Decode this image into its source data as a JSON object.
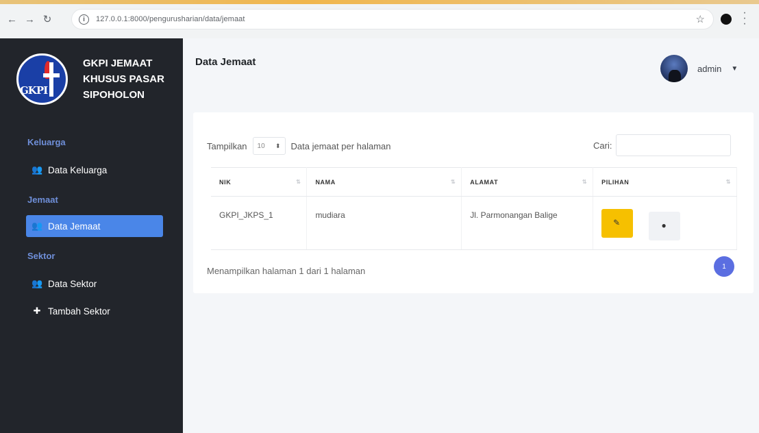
{
  "browser": {
    "url": "127.0.0.1:8000/pengurusharian/data/jemaat"
  },
  "sidebar": {
    "brand": {
      "line1": "GKPI JEMAAT",
      "line2": "KHUSUS PASAR",
      "line3": "SIPOHOLON",
      "logo_text": "GKPI"
    },
    "sections": [
      {
        "label": "Keluarga",
        "items": [
          {
            "label": "Data Keluarga",
            "icon": "users-icon"
          }
        ]
      },
      {
        "label": "Jemaat",
        "items": [
          {
            "label": "Data Jemaat",
            "icon": "users-icon",
            "active": true
          }
        ]
      },
      {
        "label": "Sektor",
        "items": [
          {
            "label": "Data Sektor",
            "icon": "users-icon"
          },
          {
            "label": "Tambah Sektor",
            "icon": "plus-icon"
          }
        ]
      }
    ]
  },
  "header": {
    "title": "Data Jemaat",
    "user": "admin"
  },
  "table_controls": {
    "show_label": "Tampilkan",
    "page_size": "10",
    "per_page_label": "Data jemaat per halaman",
    "search_label": "Cari:",
    "search_value": ""
  },
  "table": {
    "columns": [
      "NIK",
      "NAMA",
      "ALAMAT",
      "PILIHAN"
    ],
    "rows": [
      {
        "nik": "GKPI_JKPS_1",
        "nama": "mudiara",
        "alamat": "Jl. Parmonangan Balige"
      }
    ]
  },
  "pagination": {
    "info": "Menampilkan halaman 1 dari 1 halaman",
    "current": "1"
  },
  "colors": {
    "sidebar_bg": "#22252b",
    "accent": "#4a86e8",
    "edit_button": "#f6c000",
    "page_button": "#5b6ee1"
  }
}
